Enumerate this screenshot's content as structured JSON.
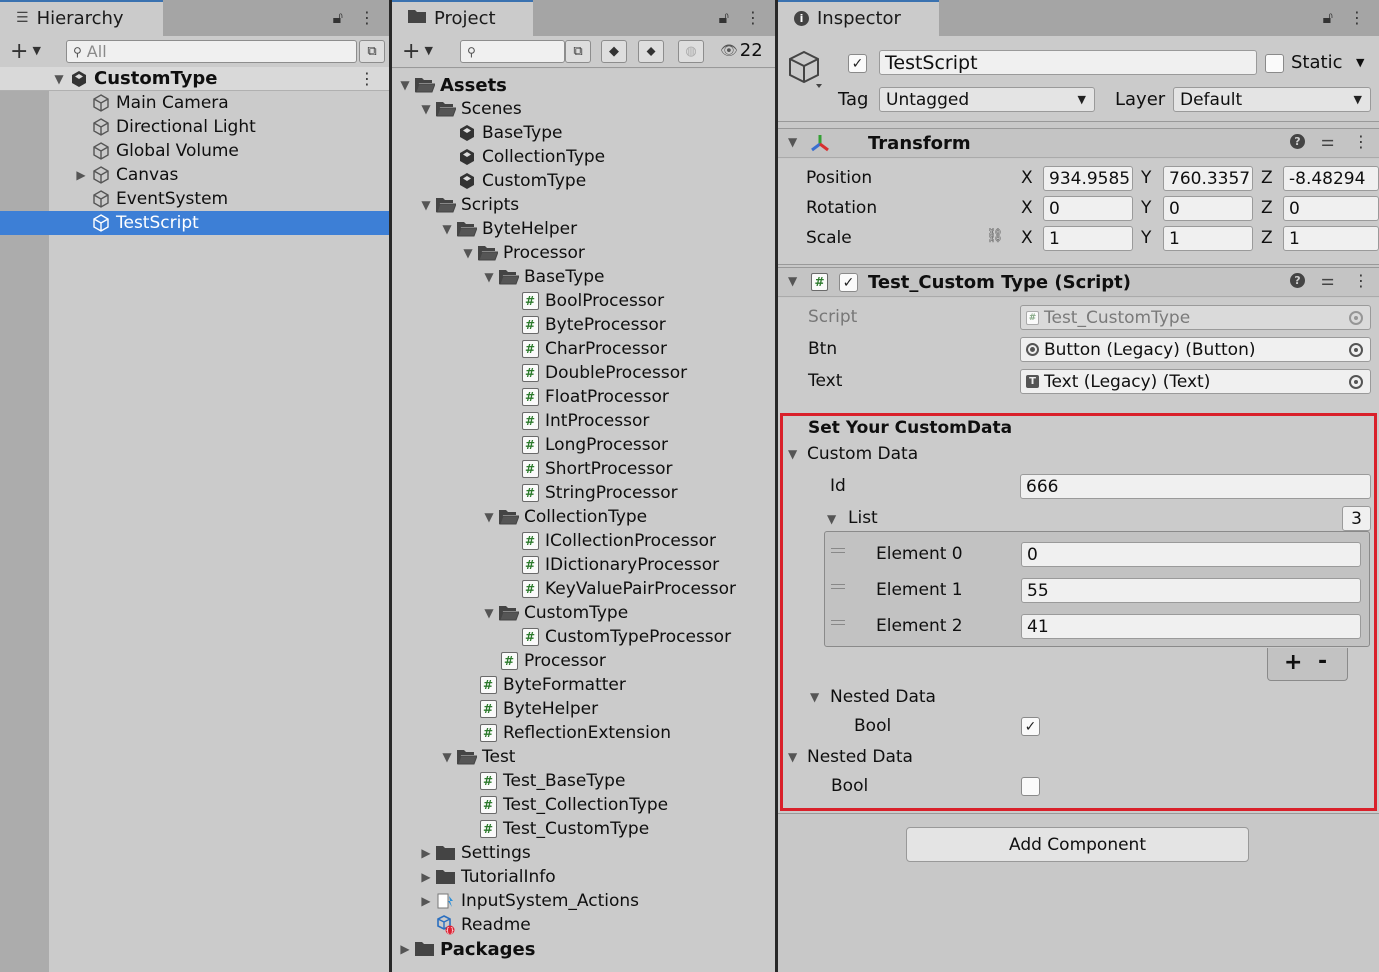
{
  "hierarchy": {
    "tab_label": "Hierarchy",
    "search_placeholder": "All",
    "scene_name": "CustomType",
    "items": [
      "Main Camera",
      "Directional Light",
      "Global Volume",
      "Canvas",
      "EventSystem",
      "TestScript"
    ]
  },
  "project": {
    "tab_label": "Project",
    "hidden_count": "22",
    "tree": [
      {
        "label": "Assets",
        "depth": 0,
        "kind": "folder",
        "expanded": true,
        "bold": true
      },
      {
        "label": "Scenes",
        "depth": 1,
        "kind": "folder",
        "expanded": true
      },
      {
        "label": "BaseType",
        "depth": 2,
        "kind": "scene"
      },
      {
        "label": "CollectionType",
        "depth": 2,
        "kind": "scene"
      },
      {
        "label": "CustomType",
        "depth": 2,
        "kind": "scene"
      },
      {
        "label": "Scripts",
        "depth": 1,
        "kind": "folder",
        "expanded": true
      },
      {
        "label": "ByteHelper",
        "depth": 2,
        "kind": "folder",
        "expanded": true
      },
      {
        "label": "Processor",
        "depth": 3,
        "kind": "folder",
        "expanded": true
      },
      {
        "label": "BaseType",
        "depth": 4,
        "kind": "folder",
        "expanded": true
      },
      {
        "label": "BoolProcessor",
        "depth": 5,
        "kind": "script"
      },
      {
        "label": "ByteProcessor",
        "depth": 5,
        "kind": "script"
      },
      {
        "label": "CharProcessor",
        "depth": 5,
        "kind": "script"
      },
      {
        "label": "DoubleProcessor",
        "depth": 5,
        "kind": "script"
      },
      {
        "label": "FloatProcessor",
        "depth": 5,
        "kind": "script"
      },
      {
        "label": "IntProcessor",
        "depth": 5,
        "kind": "script"
      },
      {
        "label": "LongProcessor",
        "depth": 5,
        "kind": "script"
      },
      {
        "label": "ShortProcessor",
        "depth": 5,
        "kind": "script"
      },
      {
        "label": "StringProcessor",
        "depth": 5,
        "kind": "script"
      },
      {
        "label": "CollectionType",
        "depth": 4,
        "kind": "folder",
        "expanded": true
      },
      {
        "label": "ICollectionProcessor",
        "depth": 5,
        "kind": "script"
      },
      {
        "label": "IDictionaryProcessor",
        "depth": 5,
        "kind": "script"
      },
      {
        "label": "KeyValuePairProcessor",
        "depth": 5,
        "kind": "script"
      },
      {
        "label": "CustomType",
        "depth": 4,
        "kind": "folder",
        "expanded": true
      },
      {
        "label": "CustomTypeProcessor",
        "depth": 5,
        "kind": "script"
      },
      {
        "label": "Processor",
        "depth": 4,
        "kind": "script"
      },
      {
        "label": "ByteFormatter",
        "depth": 3,
        "kind": "script"
      },
      {
        "label": "ByteHelper",
        "depth": 3,
        "kind": "script"
      },
      {
        "label": "ReflectionExtension",
        "depth": 3,
        "kind": "script"
      },
      {
        "label": "Test",
        "depth": 2,
        "kind": "folder",
        "expanded": true
      },
      {
        "label": "Test_BaseType",
        "depth": 3,
        "kind": "script"
      },
      {
        "label": "Test_CollectionType",
        "depth": 3,
        "kind": "script"
      },
      {
        "label": "Test_CustomType",
        "depth": 3,
        "kind": "script"
      },
      {
        "label": "Settings",
        "depth": 1,
        "kind": "folder",
        "expanded": false
      },
      {
        "label": "TutorialInfo",
        "depth": 1,
        "kind": "folder",
        "expanded": false
      },
      {
        "label": "InputSystem_Actions",
        "depth": 1,
        "kind": "input",
        "expanded": false
      },
      {
        "label": "Readme",
        "depth": 1,
        "kind": "readme"
      },
      {
        "label": "Packages",
        "depth": 0,
        "kind": "folder",
        "expanded": false,
        "bold": true
      }
    ]
  },
  "inspector": {
    "tab_label": "Inspector",
    "object_name": "TestScript",
    "static_label": "Static",
    "tag_label": "Tag",
    "tag_value": "Untagged",
    "layer_label": "Layer",
    "layer_value": "Default",
    "transform": {
      "title": "Transform",
      "position_label": "Position",
      "rotation_label": "Rotation",
      "scale_label": "Scale",
      "axis_x": "X",
      "axis_y": "Y",
      "axis_z": "Z",
      "position": [
        "934.9585",
        "760.3357",
        "-8.48294"
      ],
      "rotation": [
        "0",
        "0",
        "0"
      ],
      "scale": [
        "1",
        "1",
        "1"
      ]
    },
    "script_component": {
      "title": "Test_Custom Type (Script)",
      "script_label": "Script",
      "script_value": "Test_CustomType",
      "btn_label": "Btn",
      "btn_value": "Button (Legacy) (Button)",
      "text_label": "Text",
      "text_value": "Text (Legacy) (Text)"
    },
    "custom": {
      "header": "Set Your CustomData",
      "custom_data_label": "Custom Data",
      "id_label": "Id",
      "id_value": "666",
      "list_label": "List",
      "list_count": "3",
      "elements": [
        {
          "label": "Element 0",
          "value": "0"
        },
        {
          "label": "Element 1",
          "value": "55"
        },
        {
          "label": "Element 2",
          "value": "41"
        }
      ],
      "plus": "+",
      "minus": "-",
      "nested_label": "Nested Data",
      "bool_label": "Bool",
      "inner_bool_checked": true,
      "outer_nested_label": "Nested Data",
      "outer_bool_label": "Bool",
      "outer_bool_checked": false,
      "highlight_color": "#d9202a"
    },
    "add_component": "Add Component"
  },
  "colors": {
    "selection": "#3d7fd6",
    "panel_bg": "#c8c8c8"
  }
}
